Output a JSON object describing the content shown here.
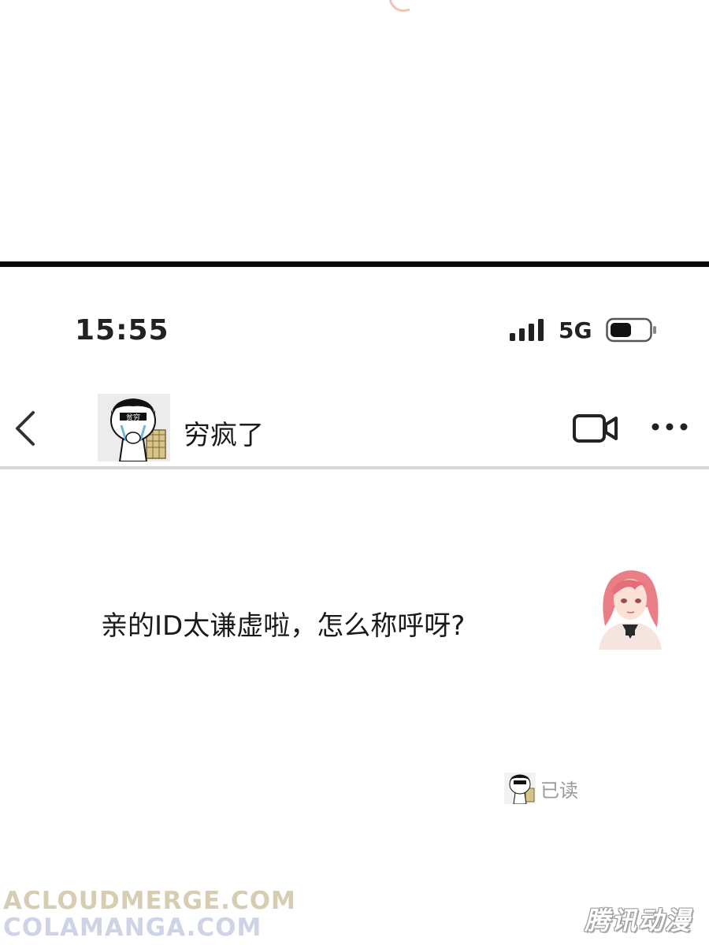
{
  "status_bar": {
    "time": "15:55",
    "network": "5G",
    "signal_icon": "signal-bars-icon",
    "battery_icon": "battery-icon"
  },
  "chat_header": {
    "back_icon": "chevron-left-icon",
    "contact_name": "穷疯了",
    "avatar_caption": "贫穷",
    "video_call_icon": "video-camera-icon",
    "more_icon": "more-dots-icon"
  },
  "message": {
    "text": "亲的ID太谦虚啦，怎么称呼呀?"
  },
  "read_receipt": {
    "label": "已读"
  },
  "watermarks": {
    "line1": "ACLOUDMERGE.COM",
    "line2": "COLAMANGA.COM",
    "brand": "腾讯动漫"
  },
  "colors": {
    "divider": "#0a0a0a",
    "header_divider": "#d8d8d8",
    "text": "#1a1a1a",
    "read_label": "#9a9a9a"
  }
}
